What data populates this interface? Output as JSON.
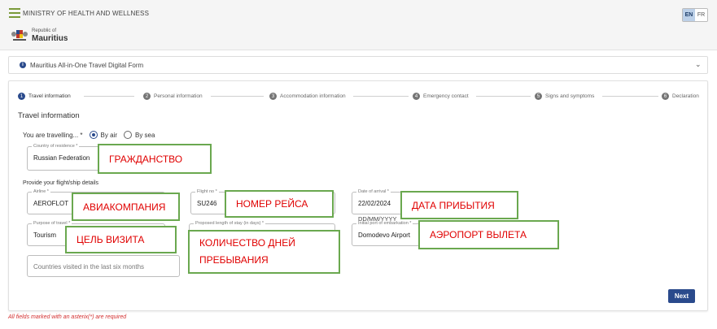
{
  "header": {
    "ministry": "MINISTRY OF HEALTH AND WELLNESS",
    "republic_small": "Republic of",
    "republic_big": "Mauritius",
    "lang_active": "EN",
    "lang_other": "FR",
    "accent_color": "#2a4a8c"
  },
  "banner": {
    "text": "Mauritius All-in-One Travel Digital Form",
    "info_icon": "i"
  },
  "steps": [
    {
      "num": "1",
      "label": "Travel information"
    },
    {
      "num": "2",
      "label": "Personal information"
    },
    {
      "num": "3",
      "label": "Accommodation information"
    },
    {
      "num": "4",
      "label": "Emergency contact"
    },
    {
      "num": "5",
      "label": "Signs and symptoms"
    },
    {
      "num": "6",
      "label": "Declaration"
    }
  ],
  "form": {
    "section_title": "Travel information",
    "travelling_question": "You are travelling... *",
    "by_air": "By air",
    "by_sea": "By sea",
    "country_label": "Country of residence *",
    "country_value": "Russian Federation",
    "flight_details": "Provide your flight/ship details",
    "airline_label": "Airline *",
    "airline_value": "AEROFLOT",
    "flight_no_label": "Flight no *",
    "flight_no_value": "SU246",
    "arrival_label": "Date of arrival *",
    "arrival_value": "22/02/2024",
    "date_hint": "DD/MM/YYYY",
    "purpose_label": "Purpose of travel *",
    "purpose_value": "Tourism",
    "stay_label": "Proposed length of stay (in days) *",
    "port_label": "Initial port of embarkation *",
    "port_value": "Domodevo Airport",
    "countries_placeholder": "Countries visited in the last six months",
    "next_label": "Next"
  },
  "footer": {
    "required_note": "All fields marked with an asterix(*) are required"
  },
  "annotations": {
    "citizenship": "ГРАЖДАНСТВО",
    "airline": "АВИАКОМПАНИЯ",
    "flight_no": "НОМЕР РЕЙСА",
    "arrival_date": "ДАТА ПРИБЫТИЯ",
    "purpose": "ЦЕЛЬ ВИЗИТА",
    "stay_line1": "КОЛИЧЕСТВО ДНЕЙ",
    "stay_line2": "ПРЕБЫВАНИЯ",
    "departure_airport": "АЭРОПОРТ ВЫЛЕТА"
  }
}
